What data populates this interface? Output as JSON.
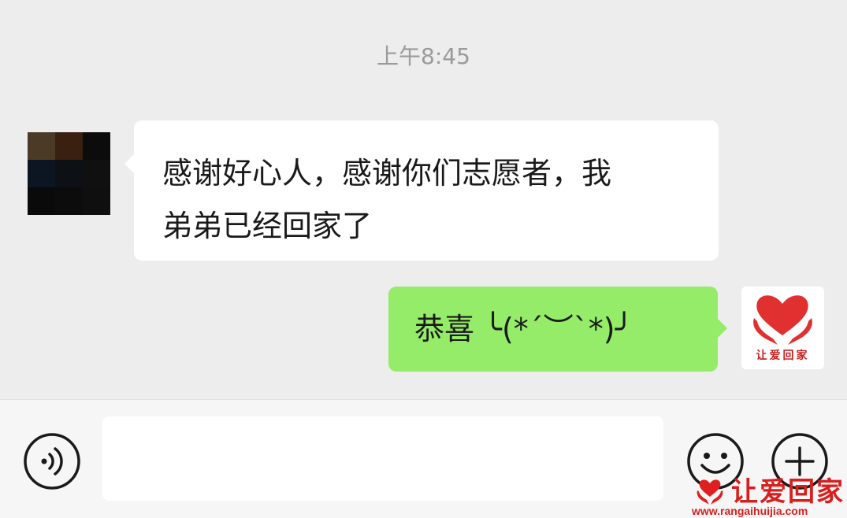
{
  "chat": {
    "timestamp": "上午8:45",
    "messages": [
      {
        "side": "left",
        "lines": [
          "感谢好心人，感谢你们志愿者，我",
          "弟弟已经回家了"
        ]
      },
      {
        "side": "right",
        "text": "恭喜 ╰(*´︶`*)╯"
      }
    ],
    "self_avatar_text": "让爱回家"
  },
  "input_bar": {
    "input_value": "",
    "voice_icon": "voice-icon",
    "emoji_icon": "emoji-icon",
    "plus_icon": "plus-icon"
  },
  "watermark": {
    "title": "让爱回家",
    "url": "www.rangaihuijia.com"
  },
  "colors": {
    "chat_background": "#ededed",
    "incoming_bubble": "#ffffff",
    "outgoing_bubble": "#95ec69",
    "brand_red": "#d91e1e",
    "timestamp_text": "#9a9a9a"
  }
}
